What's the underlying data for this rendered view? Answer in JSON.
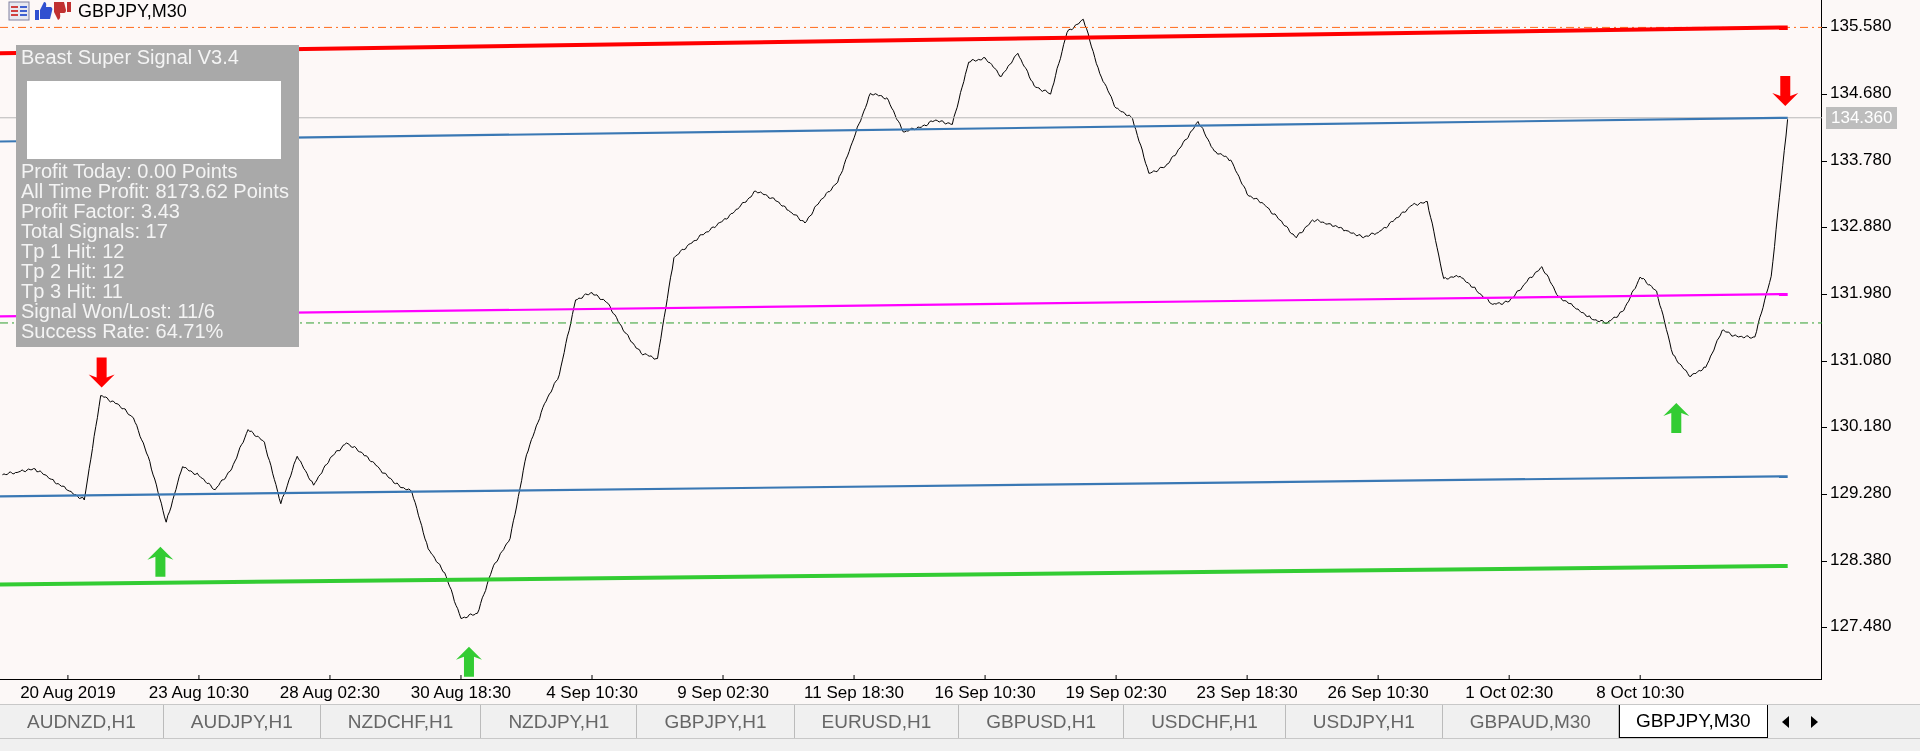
{
  "chart": {
    "title": "GBPJPY,M30",
    "indicator_panel": {
      "title": "Beast Super Signal V3.4",
      "lines": [
        "Profit Today: 0.00 Points",
        "All Time Profit: 8173.62 Points",
        "Profit Factor: 3.43",
        "Total Signals: 17",
        "Tp 1 Hit: 12",
        "Tp 2 Hit: 12",
        "Tp 3 Hit: 11",
        "Signal Won/Lost: 11/6",
        "Success Rate: 64.71%"
      ]
    },
    "current_price": "134.360",
    "chart_data": {
      "type": "line",
      "ylim": [
        126.77,
        135.95
      ],
      "categories": [
        null,
        null,
        null,
        null,
        "20 Aug 2019",
        null,
        null,
        null,
        null,
        null,
        null,
        null,
        "23 Aug 10:30",
        null,
        null,
        null,
        null,
        null,
        null,
        null,
        "28 Aug 02:30",
        null,
        null,
        null,
        null,
        null,
        null,
        null,
        "30 Aug 18:30",
        null,
        null,
        null,
        null,
        null,
        null,
        null,
        "4 Sep 10:30",
        null,
        null,
        null,
        null,
        null,
        null,
        null,
        "9 Sep 02:30",
        null,
        null,
        null,
        null,
        null,
        null,
        null,
        "11 Sep 18:30",
        null,
        null,
        null,
        null,
        null,
        null,
        null,
        "16 Sep 10:30",
        null,
        null,
        null,
        null,
        null,
        null,
        null,
        "19 Sep 02:30",
        null,
        null,
        null,
        null,
        null,
        null,
        null,
        "23 Sep 18:30",
        null,
        null,
        null,
        null,
        null,
        null,
        null,
        "26 Sep 10:30",
        null,
        null,
        null,
        null,
        null,
        null,
        null,
        "1 Oct 02:30",
        null,
        null,
        null,
        null,
        null,
        null,
        null,
        "8 Oct 10:30",
        null,
        null,
        null,
        null,
        null,
        null,
        null,
        null,
        null
      ],
      "series": [
        {
          "color": "#000000",
          "values": [
            129.54,
            129.58,
            129.62,
            129.48,
            129.33,
            129.2,
            130.61,
            130.5,
            130.31,
            129.72,
            128.9,
            129.65,
            129.53,
            129.34,
            129.62,
            130.15,
            129.98,
            129.15,
            129.79,
            129.4,
            129.76,
            129.97,
            129.83,
            129.63,
            129.42,
            129.31,
            128.54,
            128.22,
            127.6,
            127.67,
            128.32,
            128.68,
            129.81,
            130.45,
            130.89,
            131.9,
            132.0,
            131.85,
            131.46,
            131.18,
            131.11,
            132.47,
            132.66,
            132.82,
            132.97,
            133.15,
            133.37,
            133.28,
            133.11,
            132.94,
            133.26,
            133.49,
            134.09,
            134.69,
            134.63,
            134.17,
            134.23,
            134.33,
            134.27,
            135.11,
            135.17,
            134.92,
            135.23,
            134.79,
            134.68,
            135.51,
            135.69,
            134.96,
            134.49,
            134.35,
            133.61,
            133.7,
            133.98,
            134.31,
            133.91,
            133.79,
            133.33,
            133.2,
            132.98,
            132.74,
            132.98,
            132.93,
            132.84,
            132.75,
            132.81,
            132.98,
            133.17,
            133.23,
            132.19,
            132.22,
            132.03,
            131.84,
            131.88,
            132.13,
            132.35,
            131.95,
            131.8,
            131.65,
            131.59,
            131.76,
            132.21,
            132.02,
            131.16,
            130.87,
            130.99,
            131.49,
            131.4,
            131.4,
            132.22,
            134.34
          ]
        }
      ],
      "yticks": [
        {
          "value": 135.58,
          "label": "135.580"
        },
        {
          "value": 134.68,
          "label": "134.680"
        },
        {
          "value": 133.78,
          "label": "133.780"
        },
        {
          "value": 132.88,
          "label": "132.880"
        },
        {
          "value": 131.98,
          "label": "131.980"
        },
        {
          "value": 131.08,
          "label": "131.080"
        },
        {
          "value": 130.18,
          "label": "130.180"
        },
        {
          "value": 129.28,
          "label": "129.280"
        },
        {
          "value": 128.38,
          "label": "128.380"
        },
        {
          "value": 127.48,
          "label": "127.480"
        }
      ]
    }
  },
  "tabs": [
    {
      "label": "AUDNZD,H1",
      "selected": false
    },
    {
      "label": "AUDJPY,H1",
      "selected": false
    },
    {
      "label": "NZDCHF,H1",
      "selected": false
    },
    {
      "label": "NZDJPY,H1",
      "selected": false
    },
    {
      "label": "GBPJPY,H1",
      "selected": false
    },
    {
      "label": "EURUSD,H1",
      "selected": false
    },
    {
      "label": "GBPUSD,H1",
      "selected": false
    },
    {
      "label": "USDCHF,H1",
      "selected": false
    },
    {
      "label": "USDJPY,H1",
      "selected": false
    },
    {
      "label": "GBPAUD,M30",
      "selected": false
    },
    {
      "label": "GBPJPY,M30",
      "selected": true
    }
  ]
}
